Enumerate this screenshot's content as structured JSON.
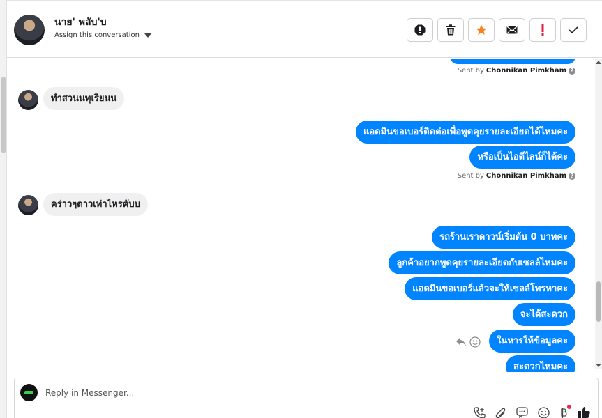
{
  "header": {
    "contact_name": "นาย' พลับ'บ",
    "assign_label": "Assign this conversation"
  },
  "toolbar": {
    "actions": [
      "spam-icon",
      "trash-icon",
      "star-icon",
      "envelope-icon",
      "exclamation-icon",
      "check-icon"
    ],
    "star_color": "#f5821f",
    "exclamation_color": "#e41e3f"
  },
  "chat": {
    "sent_by_prefix": "Sent by",
    "agent_name": "Chonnikan Pimkham",
    "messages": [
      {
        "dir": "in",
        "text": "ทำสวนนทุเรียนน"
      },
      {
        "dir": "out",
        "text": "แอดมินขอเบอร์ติดต่อเพื่อพูดคุยรายละเอียดได้ไหมคะ"
      },
      {
        "dir": "out",
        "text": "หรือเป็นไอดีไลน์ก็ได้คะ"
      },
      {
        "dir": "in",
        "text": "คร่าวๆดาวเท่าไหรคับบ"
      },
      {
        "dir": "out",
        "text": "รถร้านเราดาวน์เริ่มต้น 0 บาทคะ"
      },
      {
        "dir": "out",
        "text": "ลูกค้าอยากพูดคุยรายละเอียดกับเซลล์ไหมคะ"
      },
      {
        "dir": "out",
        "text": "แอดมินขอเบอร์แล้วจะให้เซลล์โทรหาคะ"
      },
      {
        "dir": "out",
        "text": "จะได้สะดวก"
      },
      {
        "dir": "out",
        "text": "ในหารให้ข้อมูลคะ"
      },
      {
        "dir": "out",
        "text": "สะดวกไหมคะ"
      }
    ]
  },
  "composer": {
    "placeholder": "Reply in Messenger...",
    "tools": [
      "call-add-icon",
      "attachment-icon",
      "saved-reply-icon",
      "emoji-icon",
      "payment-icon",
      "like-icon"
    ]
  },
  "colors": {
    "outgoing_bubble": "#0084ff",
    "incoming_bubble": "#f0f0f0"
  }
}
